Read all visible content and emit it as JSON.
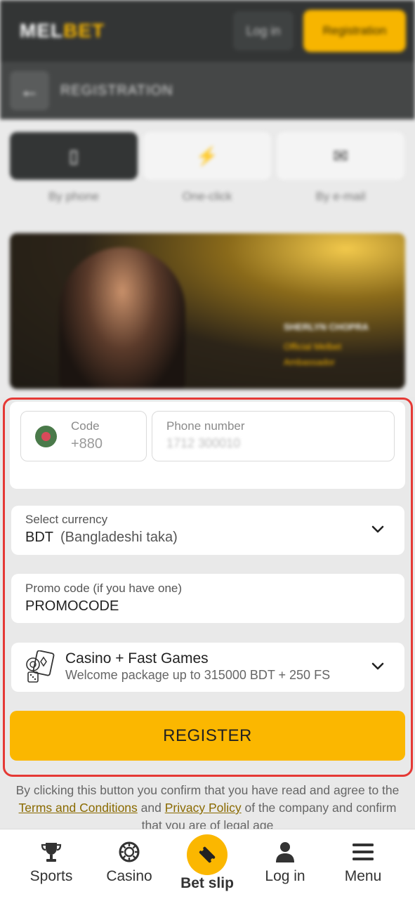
{
  "header": {
    "logo_main": "MEL",
    "logo_accent": "BET",
    "login_label": "Log in",
    "register_label": "Registration"
  },
  "subheader": {
    "title": "REGISTRATION"
  },
  "tabs": [
    {
      "label": "By phone",
      "icon": "phone-icon"
    },
    {
      "label": "One-click",
      "icon": "lightning-icon"
    },
    {
      "label": "By e-mail",
      "icon": "mail-icon"
    }
  ],
  "banner": {
    "name": "SHERLYN CHOPRA",
    "role_line1": "Official Melbet",
    "role_line2": "Ambassador"
  },
  "form": {
    "code_label": "Code",
    "code_value": "+880",
    "phone_label": "Phone number",
    "phone_value": "1712 300010",
    "currency_label": "Select currency",
    "currency_code": "BDT",
    "currency_name": "(Bangladeshi taka)",
    "promo_label": "Promo code (if you have one)",
    "promo_value": "PROMOCODE",
    "bonus_title": "Casino + Fast Games",
    "bonus_desc": "Welcome package up to 315000 BDT + 250 FS",
    "register_label": "REGISTER"
  },
  "legal": {
    "text_before": "By clicking this button you confirm that you have read and agree to the ",
    "terms_link": "Terms and Conditions",
    "and": " and ",
    "privacy_link": "Privacy Policy",
    "text_after": " of the company and confirm that you are of legal age"
  },
  "bottom_nav": {
    "sports": "Sports",
    "casino": "Casino",
    "betslip": "Bet slip",
    "login": "Log in",
    "menu": "Menu"
  },
  "colors": {
    "accent": "#fbb700",
    "header_bg": "#333535",
    "highlight_border": "#e53935"
  }
}
